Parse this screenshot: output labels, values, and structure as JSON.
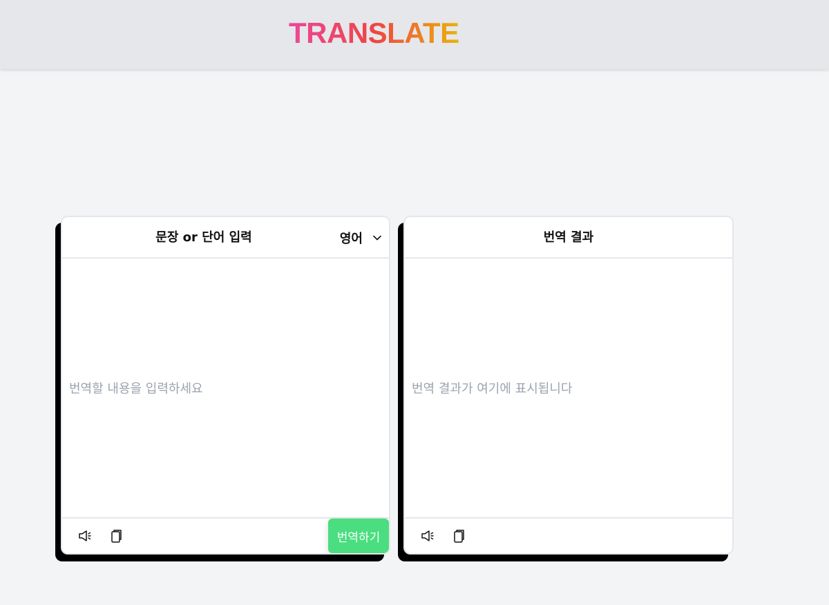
{
  "app": {
    "logo": "TRANSLATE"
  },
  "source_panel": {
    "title": "문장 or 단어 입력",
    "language": {
      "selected": "영어",
      "icon": "chevron-down-icon"
    },
    "input": {
      "value": "",
      "placeholder": "번역할 내용을 입력하세요"
    },
    "footer": {
      "speak_icon": "speaker-icon",
      "copy_icon": "copy-icon",
      "translate_label": "번역하기"
    }
  },
  "result_panel": {
    "title": "번역 결과",
    "output": {
      "value": "",
      "placeholder": "번역 결과가 여기에 표시됩니다"
    },
    "footer": {
      "speak_icon": "speaker-icon",
      "copy_icon": "copy-icon"
    }
  },
  "colors": {
    "logo_gradient": [
      "#ec4899",
      "#ef4444",
      "#eab308"
    ],
    "translate_button": "#4ade80",
    "panel_border": "#e5e7eb",
    "placeholder_text": "#9ca3af",
    "background": "#f3f4f6"
  }
}
